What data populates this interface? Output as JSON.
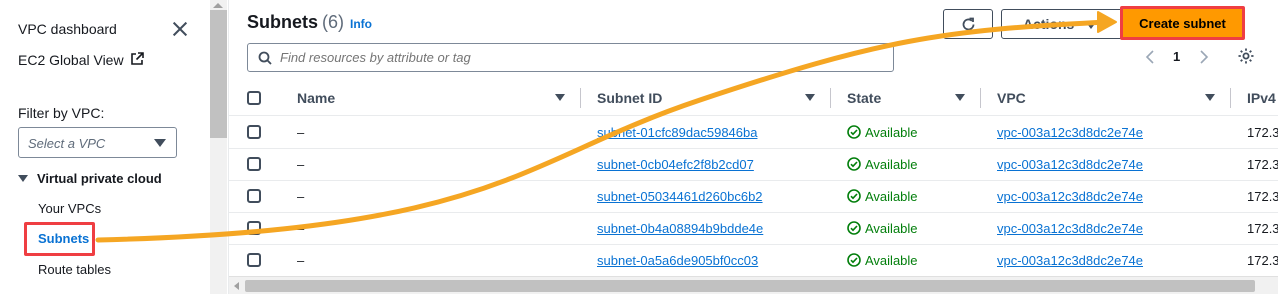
{
  "sidebar": {
    "vpc_dashboard": "VPC dashboard",
    "ec2_global_view": "EC2 Global View",
    "filter_label": "Filter by VPC:",
    "select_placeholder": "Select a VPC",
    "section_title": "Virtual private cloud",
    "items": [
      "Your VPCs",
      "Subnets",
      "Route tables"
    ],
    "active_item": "Subnets"
  },
  "header": {
    "title": "Subnets",
    "count": "(6)",
    "info": "Info",
    "actions_label": "Actions",
    "create_label": "Create subnet"
  },
  "search": {
    "placeholder": "Find resources by attribute or tag"
  },
  "pagination": {
    "current_page": "1"
  },
  "table": {
    "columns": [
      "Name",
      "Subnet ID",
      "State",
      "VPC",
      "IPv4"
    ],
    "rows": [
      {
        "name": "–",
        "subnet_id": "subnet-01cfc89dac59846ba",
        "state": "Available",
        "vpc": "vpc-003a12c3d8dc2e74e",
        "ipv4": "172.3"
      },
      {
        "name": "–",
        "subnet_id": "subnet-0cb04efc2f8b2cd07",
        "state": "Available",
        "vpc": "vpc-003a12c3d8dc2e74e",
        "ipv4": "172.3"
      },
      {
        "name": "–",
        "subnet_id": "subnet-05034461d260bc6b2",
        "state": "Available",
        "vpc": "vpc-003a12c3d8dc2e74e",
        "ipv4": "172.3"
      },
      {
        "name": "–",
        "subnet_id": "subnet-0b4a08894b9bdde4e",
        "state": "Available",
        "vpc": "vpc-003a12c3d8dc2e74e",
        "ipv4": "172.3"
      },
      {
        "name": "–",
        "subnet_id": "subnet-0a5a6de905bf0cc03",
        "state": "Available",
        "vpc": "vpc-003a12c3d8dc2e74e",
        "ipv4": "172.3"
      }
    ]
  },
  "colors": {
    "link": "#0972d3",
    "primary_button": "#ff9900",
    "highlight": "#ef3e42",
    "annotation_arrow": "#f5a623",
    "available": "#037f0c"
  },
  "icons": {
    "close": "close-icon",
    "external": "external-link-icon",
    "refresh": "refresh-icon",
    "search": "search-icon",
    "settings": "gear-icon",
    "status_ok": "check-circle-icon"
  }
}
